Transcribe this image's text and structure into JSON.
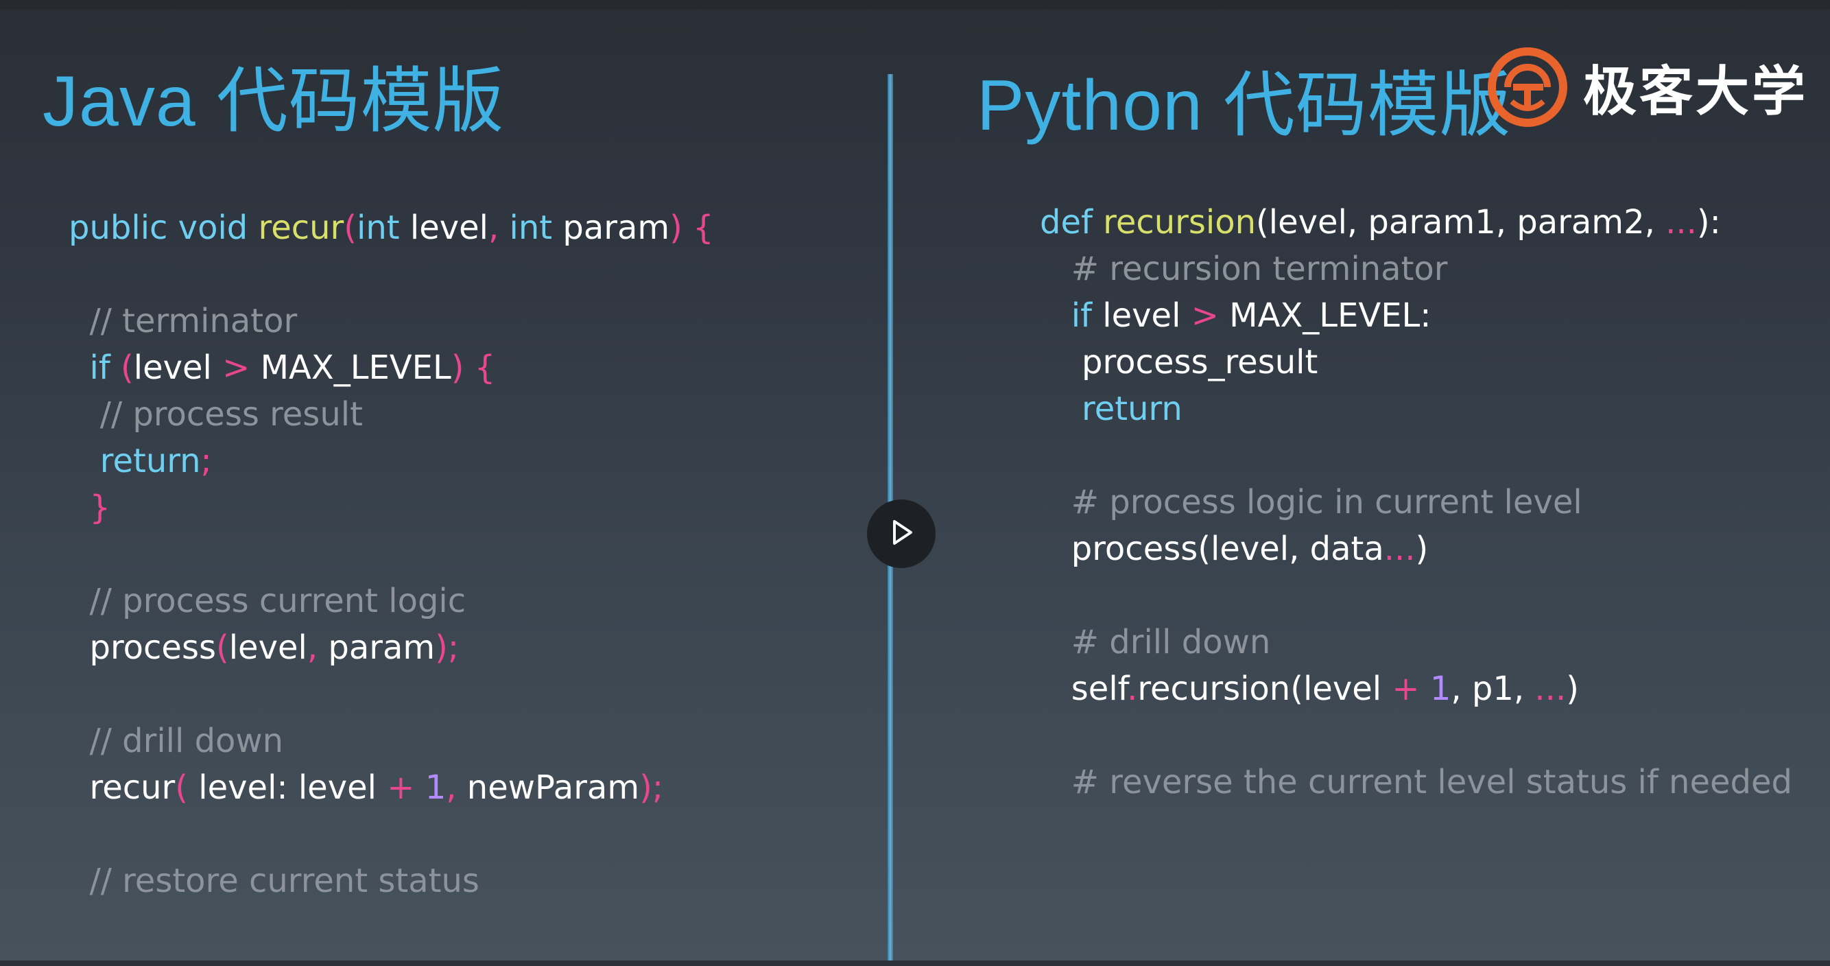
{
  "java": {
    "title": "Java 代码模版",
    "lines": [
      [
        [
          "kw",
          "public void "
        ],
        [
          "fn",
          "recur"
        ],
        [
          "pu",
          "("
        ],
        [
          "kw",
          "int "
        ],
        [
          "tx",
          "level"
        ],
        [
          "pu",
          ", "
        ],
        [
          "kw",
          "int "
        ],
        [
          "tx",
          "param"
        ],
        [
          "pu",
          ") {"
        ]
      ],
      [],
      [
        [
          "tx",
          "  "
        ],
        [
          "cm",
          "// terminator"
        ]
      ],
      [
        [
          "tx",
          "  "
        ],
        [
          "kw",
          "if "
        ],
        [
          "pu",
          "("
        ],
        [
          "tx",
          "level "
        ],
        [
          "pu",
          "> "
        ],
        [
          "tx",
          "MAX_LEVEL"
        ],
        [
          "pu",
          ") {"
        ]
      ],
      [
        [
          "tx",
          "   "
        ],
        [
          "cm",
          "// process result"
        ]
      ],
      [
        [
          "tx",
          "   "
        ],
        [
          "kw",
          "return"
        ],
        [
          "pu",
          ";"
        ]
      ],
      [
        [
          "tx",
          "  "
        ],
        [
          "pu",
          "}"
        ]
      ],
      [],
      [
        [
          "tx",
          "  "
        ],
        [
          "cm",
          "// process current logic"
        ]
      ],
      [
        [
          "tx",
          "  "
        ],
        [
          "tx",
          "process"
        ],
        [
          "pu",
          "("
        ],
        [
          "tx",
          "level"
        ],
        [
          "pu",
          ", "
        ],
        [
          "tx",
          "param"
        ],
        [
          "pu",
          ");"
        ]
      ],
      [],
      [
        [
          "tx",
          "  "
        ],
        [
          "cm",
          "// drill down"
        ]
      ],
      [
        [
          "tx",
          "  "
        ],
        [
          "tx",
          "recur"
        ],
        [
          "pu",
          "( "
        ],
        [
          "tx",
          "level: level "
        ],
        [
          "pu",
          "+ "
        ],
        [
          "num",
          "1"
        ],
        [
          "pu",
          ", "
        ],
        [
          "tx",
          "newParam"
        ],
        [
          "pu",
          ");"
        ]
      ],
      [],
      [
        [
          "tx",
          "  "
        ],
        [
          "cm",
          "// restore current status"
        ]
      ]
    ]
  },
  "python": {
    "title": "Python 代码模版",
    "lines": [
      [
        [
          "kw",
          "def "
        ],
        [
          "fn",
          "recursion"
        ],
        [
          "tx",
          "(level, param1, param2, "
        ],
        [
          "pu",
          "..."
        ],
        [
          "tx",
          "):"
        ]
      ],
      [
        [
          "tx",
          "   "
        ],
        [
          "cm",
          "# recursion terminator"
        ]
      ],
      [
        [
          "tx",
          "   "
        ],
        [
          "kw",
          "if "
        ],
        [
          "tx",
          "level "
        ],
        [
          "pu",
          "> "
        ],
        [
          "tx",
          "MAX_LEVEL:"
        ]
      ],
      [
        [
          "tx",
          "    "
        ],
        [
          "tx",
          "process_result"
        ]
      ],
      [
        [
          "tx",
          "    "
        ],
        [
          "kw",
          "return"
        ]
      ],
      [],
      [
        [
          "tx",
          "   "
        ],
        [
          "cm",
          "# process logic in current level"
        ]
      ],
      [
        [
          "tx",
          "   "
        ],
        [
          "tx",
          "process(level, data"
        ],
        [
          "pu",
          "..."
        ],
        [
          "tx",
          ")"
        ]
      ],
      [],
      [
        [
          "tx",
          "   "
        ],
        [
          "cm",
          "# drill down"
        ]
      ],
      [
        [
          "tx",
          "   "
        ],
        [
          "tx",
          "self"
        ],
        [
          "pu",
          "."
        ],
        [
          "tx",
          "recursion(level "
        ],
        [
          "pu",
          "+ "
        ],
        [
          "num",
          "1"
        ],
        [
          "tx",
          ", p1, "
        ],
        [
          "pu",
          "..."
        ],
        [
          "tx",
          ")"
        ]
      ],
      [],
      [
        [
          "tx",
          "   "
        ],
        [
          "cm",
          "# reverse the current level status if needed"
        ]
      ]
    ]
  },
  "logo": {
    "text": "极客大学",
    "icon": "geekbang-logo-icon",
    "color": "#e8642c"
  },
  "player": {
    "icon": "play-icon"
  },
  "colors": {
    "heading": "#3fb1e3",
    "keyword": "#6fcff0",
    "function": "#d8e06a",
    "punctuation": "#e8468f",
    "comment": "#8d939a",
    "number": "#b48aff"
  }
}
